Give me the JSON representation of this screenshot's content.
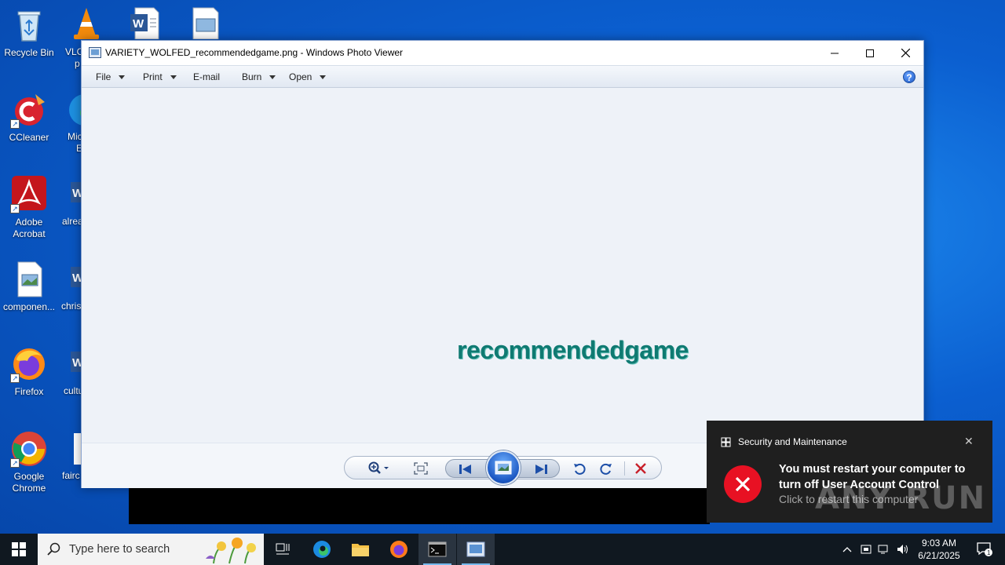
{
  "desktop": {
    "icons": [
      {
        "label": "Recycle Bin"
      },
      {
        "label": "CCleaner"
      },
      {
        "label": "Adobe Acrobat"
      },
      {
        "label": "componen..."
      },
      {
        "label": "Firefox"
      },
      {
        "label": "Google Chrome"
      }
    ],
    "partial_labels": [
      "VLC",
      "p",
      "Mic",
      "E",
      "alrea",
      "chris",
      "cultu",
      "fairc"
    ]
  },
  "photo_viewer": {
    "title": "VARIETY_WOLFED_recommendedgame.png - Windows Photo Viewer",
    "menu": {
      "file": "File",
      "print": "Print",
      "email": "E-mail",
      "burn": "Burn",
      "open": "Open"
    },
    "help": "?",
    "image_text": "recommendedgame"
  },
  "notification": {
    "source": "Security and Maintenance",
    "message": "You must restart your computer to turn off User Account Control",
    "sub": "Click to restart this computer"
  },
  "watermark": "ANY RUN",
  "taskbar": {
    "search_placeholder": "Type here to search",
    "time": "9:03 AM",
    "date": "6/21/2025",
    "notification_count": "1"
  }
}
